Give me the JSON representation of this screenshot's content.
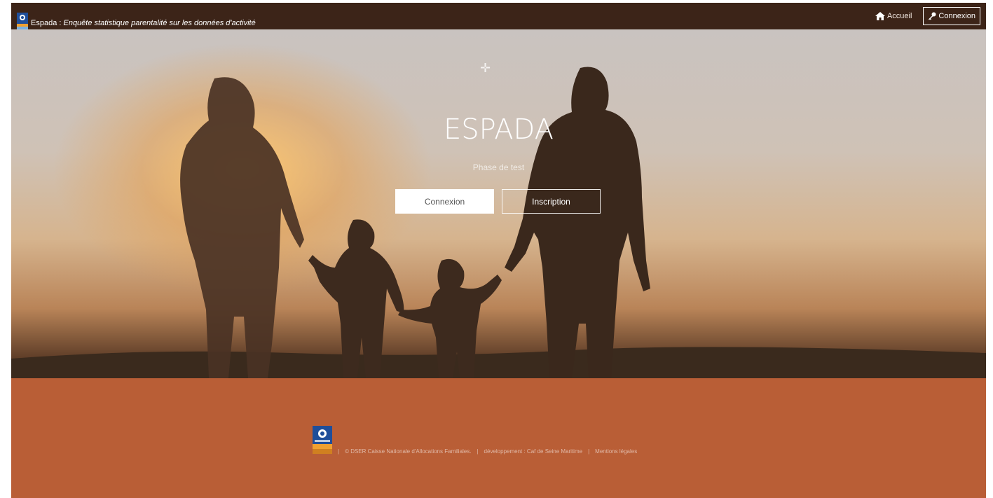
{
  "navbar": {
    "brand_name": "Espada : ",
    "brand_subtitle": "Enquête statistique parentalité sur les données d'activité",
    "home_label": "Accueil",
    "login_label": "Connexion"
  },
  "hero": {
    "title": "ESPADA",
    "subtitle": "Phase de test",
    "login_button": "Connexion",
    "register_button": "Inscription"
  },
  "footer": {
    "copyright": "© DSER Caisse Nationale d'Allocations Familiales.",
    "development": "développement : Caf de Seine Maritime",
    "legal": "Mentions légales"
  },
  "colors": {
    "navbar_bg": "#3c2418",
    "footer_bg": "#b95e36",
    "accent_white": "#ffffff"
  },
  "icons": {
    "home": "home-icon",
    "key": "key-icon",
    "logo": "caf-logo-icon"
  }
}
